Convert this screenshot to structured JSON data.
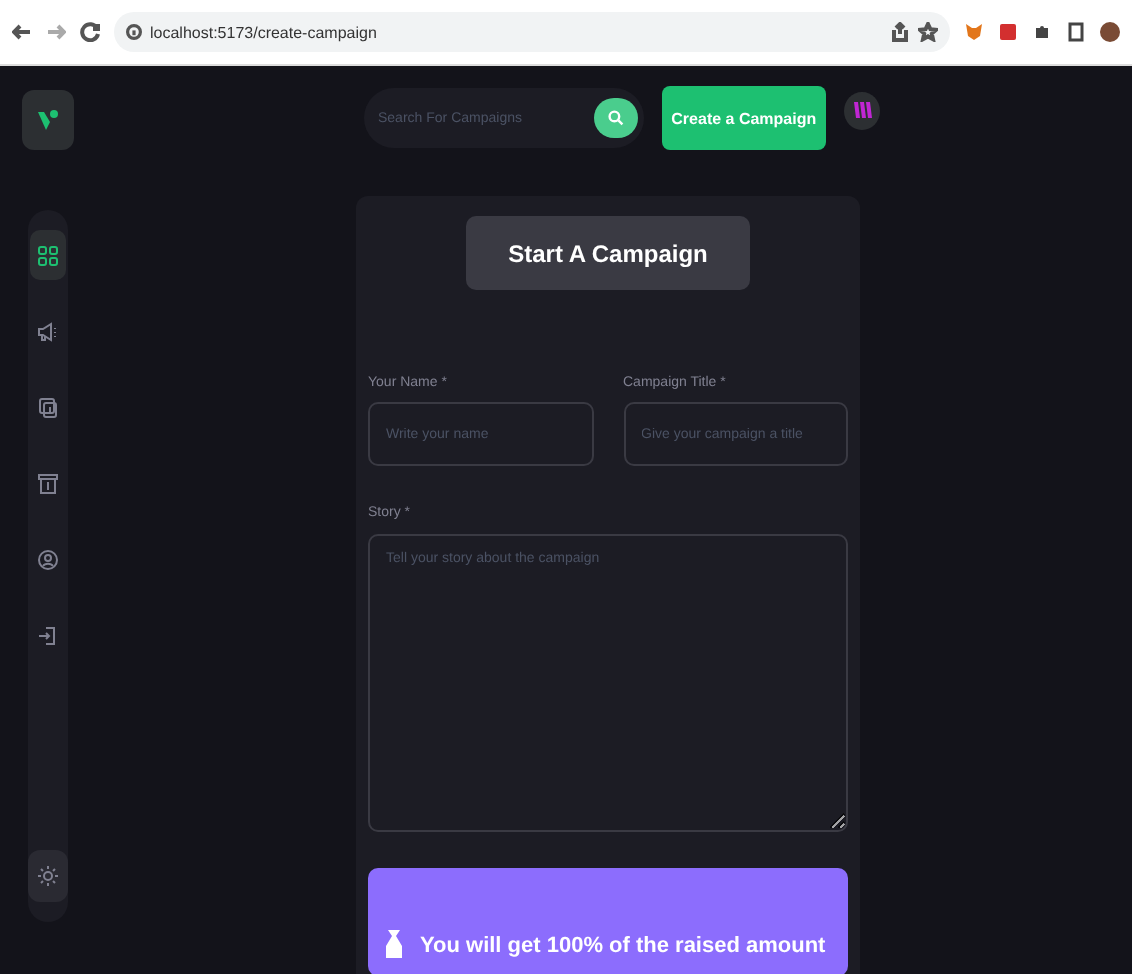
{
  "browser": {
    "url": "localhost:5173/create-campaign"
  },
  "sidebar": {
    "items": [
      {
        "kind": "dashboard",
        "selected": true
      },
      {
        "kind": "campaign",
        "selected": false
      },
      {
        "kind": "payment",
        "selected": false
      },
      {
        "kind": "withdraw",
        "selected": false
      },
      {
        "kind": "profile",
        "selected": false
      },
      {
        "kind": "logout",
        "selected": false
      }
    ]
  },
  "search": {
    "placeholder": "Search For Campaigns"
  },
  "create_button": "Create a Campaign",
  "form": {
    "title": "Start A Campaign",
    "fields": [
      {
        "label": "Your Name *",
        "placeholder": "Write your name"
      },
      {
        "label": "Campaign Title *",
        "placeholder": "Give your campaign a title"
      }
    ],
    "story": {
      "label": "Story *",
      "placeholder": "Tell your story about the campaign"
    },
    "banner": "You will get 100% of the raised amount"
  }
}
